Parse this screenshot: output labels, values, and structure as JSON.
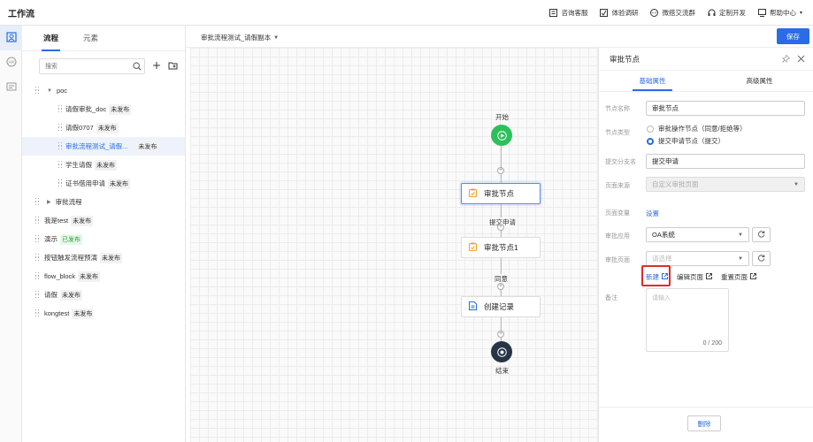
{
  "app": {
    "title": "工作流"
  },
  "top_actions": [
    {
      "label": "咨询客服",
      "icon": "chat-box-icon"
    },
    {
      "label": "体验调研",
      "icon": "survey-icon"
    },
    {
      "label": "微搭交流群",
      "icon": "wechat-icon"
    },
    {
      "label": "定制开发",
      "icon": "headset-icon"
    },
    {
      "label": "帮助中心",
      "icon": "help-monitor-icon",
      "dropdown": true
    }
  ],
  "left_panel": {
    "tabs": [
      "流程",
      "元素"
    ],
    "active_tab": "流程",
    "search_placeholder": "搜索",
    "tree": [
      {
        "label": "poc",
        "level": 0,
        "expanded": true,
        "badge": ""
      },
      {
        "label": "请假审批_doc",
        "level": 1,
        "badge": "未发布"
      },
      {
        "label": "请假0707",
        "level": 1,
        "badge": "未发布"
      },
      {
        "label": "审批流程测试_请假...",
        "level": 1,
        "badge": "未发布",
        "selected": true
      },
      {
        "label": "学生请假",
        "level": 1,
        "badge": "未发布"
      },
      {
        "label": "证书借用申请",
        "level": 1,
        "badge": "未发布"
      },
      {
        "label": "审批流程",
        "level": 0,
        "expanded": false,
        "badge": ""
      },
      {
        "label": "我是test",
        "level": -1,
        "badge": "未发布"
      },
      {
        "label": "演示",
        "level": -1,
        "badge": "已发布",
        "green": true
      },
      {
        "label": "按钮触发流程预演",
        "level": -1,
        "badge": "未发布"
      },
      {
        "label": "flow_block",
        "level": -1,
        "badge": "未发布"
      },
      {
        "label": "请假",
        "level": -1,
        "badge": "未发布"
      },
      {
        "label": "kongtest",
        "level": -1,
        "badge": "未发布"
      }
    ]
  },
  "canvas": {
    "breadcrumb": "审批流程测试_请假副本",
    "save_label": "保存",
    "start_label": "开始",
    "end_label": "结束",
    "nodes": [
      "审批节点",
      "审批节点1",
      "创建记录"
    ],
    "edge_labels": [
      "提交申请",
      "同意"
    ]
  },
  "right_panel": {
    "title": "审批节点",
    "tabs": [
      "基础属性",
      "高级属性"
    ],
    "fields": {
      "node_name_label": "节点名称",
      "node_name_value": "审批节点",
      "node_type_label": "节点类型",
      "node_type_options": [
        "审批操作节点（同意/拒绝等）",
        "提交申请节点（提交）"
      ],
      "node_type_selected": 1,
      "submit_branch_label": "提交分支名",
      "submit_branch_value": "提交申请",
      "page_source_label": "页面来源",
      "page_source_value": "自定义审批页面",
      "page_var_label": "页面变量",
      "page_var_link": "设置",
      "approval_app_label": "审批应用",
      "approval_app_value": "OA系统",
      "approval_page_label": "审批页面",
      "approval_page_placeholder": "请选择",
      "new_link": "新建",
      "edit_link": "编辑页面",
      "reset_link": "重置页面",
      "remark_label": "备注",
      "remark_placeholder": "请输入",
      "remark_counter": "0 / 200"
    },
    "delete_label": "删除"
  },
  "colors": {
    "primary": "#2a6ce5",
    "start": "#2dc05a",
    "end": "#273447",
    "highlight": "#d93026"
  }
}
